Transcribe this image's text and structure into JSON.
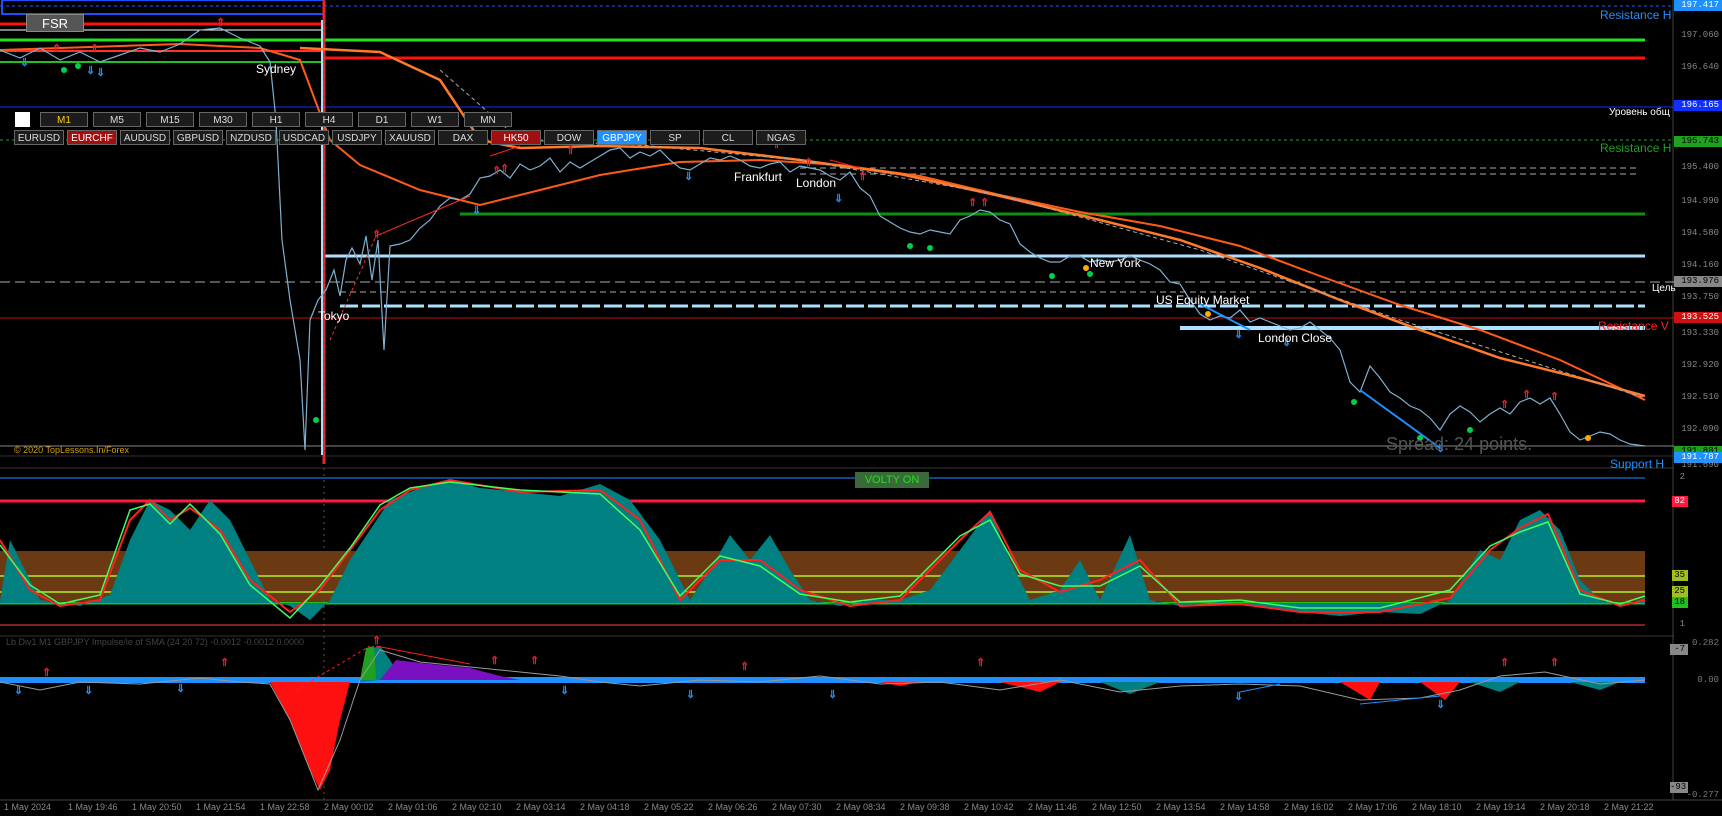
{
  "window": {
    "fsr_label": "FSR",
    "copyright": "© 2020 TopLessons.In/Forex",
    "volty_label": "VOLTY ON",
    "spread_label": "Spread: 24 points.",
    "indicator_caption": "Lb Div1 M1 GBPJPY Impulse/ie of SMA (24 20 72) -0.0012 -0.0012 0.0000"
  },
  "timeframes": [
    "M1",
    "M5",
    "M15",
    "M30",
    "H1",
    "H4",
    "D1",
    "W1",
    "MN"
  ],
  "symbols": [
    "EURUSD",
    "EURCHF",
    "AUDUSD",
    "GBPUSD",
    "NZDUSD",
    "USDCAD",
    "USDJPY",
    "XAUUSD",
    "DAX",
    "HK50",
    "DOW",
    "GBPJPY",
    "SP",
    "CL",
    "NGAS"
  ],
  "active_symbol": "GBPJPY",
  "highlight_symbols": [
    "EURCHF",
    "HK50"
  ],
  "sessions": [
    "Sydney",
    "Tokyo",
    "Frankfurt",
    "London",
    "New York",
    "US Equity Market",
    "London Close"
  ],
  "line_labels": {
    "resistance_top": "Resistance H",
    "level": "Уровень общ",
    "resistance_mid": "Resistance H",
    "target": "Цель",
    "resistance_v": "Resistance V",
    "support": "Support H"
  },
  "price_axis": [
    "197.417",
    "197.060",
    "196.640",
    "196.165",
    "195.743",
    "195.400",
    "194.990",
    "194.580",
    "194.160",
    "193.976",
    "193.750",
    "193.525",
    "193.330",
    "192.920",
    "192.510",
    "192.090",
    "191.881",
    "191.787",
    "191.690"
  ],
  "price_axis_extra": [
    "191.787",
    "191.881"
  ],
  "osc_axis": [
    "2",
    "82",
    "35",
    "25",
    "18",
    "1"
  ],
  "impulse_axis": [
    "0.282",
    "-7",
    "0.00",
    "-93",
    "-0.277"
  ],
  "time_axis": [
    "1 May 2024",
    "1 May 19:46",
    "1 May 20:50",
    "1 May 21:54",
    "1 May 22:58",
    "2 May 00:02",
    "2 May 01:06",
    "2 May 02:10",
    "2 May 03:14",
    "2 May 04:18",
    "2 May 05:22",
    "2 May 06:26",
    "2 May 07:30",
    "2 May 08:34",
    "2 May 09:38",
    "2 May 10:42",
    "2 May 11:46",
    "2 May 12:50",
    "2 May 13:54",
    "2 May 14:58",
    "2 May 16:02",
    "2 May 17:06",
    "2 May 18:10",
    "2 May 19:14",
    "2 May 20:18",
    "2 May 21:22"
  ],
  "colors": {
    "accent": "#1e90ff",
    "resistance": "#ff2020",
    "support_green": "#00c000",
    "osc_fill": "#008080",
    "osc_zone": "#6b3a12"
  }
}
